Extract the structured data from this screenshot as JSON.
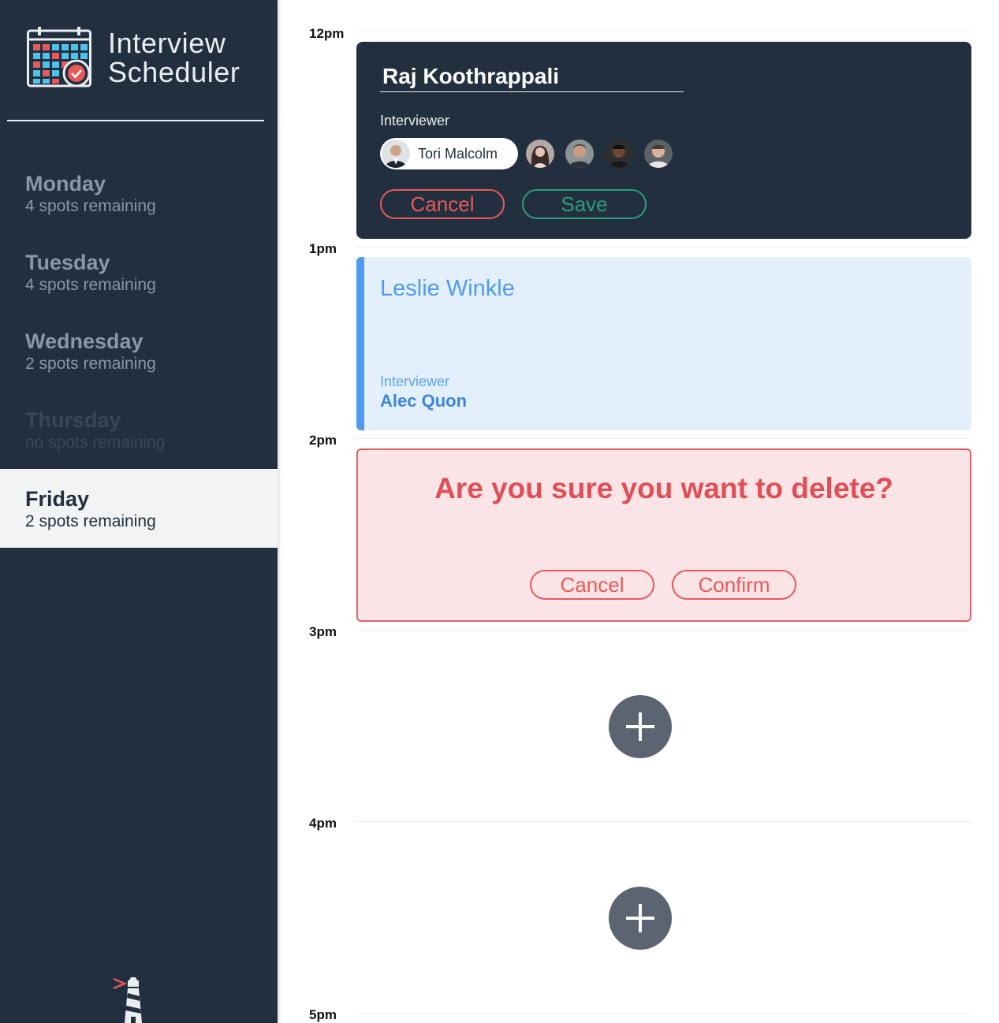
{
  "app": {
    "title_line1": "Interview",
    "title_line2": "Scheduler"
  },
  "sidebar": {
    "days": [
      {
        "name": "Monday",
        "spots": "4 spots remaining",
        "state": "available"
      },
      {
        "name": "Tuesday",
        "spots": "4 spots remaining",
        "state": "available"
      },
      {
        "name": "Wednesday",
        "spots": "2 spots remaining",
        "state": "available"
      },
      {
        "name": "Thursday",
        "spots": "no spots remaining",
        "state": "full"
      },
      {
        "name": "Friday",
        "spots": "2 spots remaining",
        "state": "selected"
      }
    ]
  },
  "schedule": {
    "hours": [
      "12pm",
      "1pm",
      "2pm",
      "3pm",
      "4pm",
      "5pm"
    ],
    "edit_form": {
      "student_name": "Raj Koothrappali",
      "interviewer_label": "Interviewer",
      "selected_interviewer": "Tori Malcolm",
      "other_interviewers_count": 4,
      "cancel_label": "Cancel",
      "save_label": "Save"
    },
    "appointment": {
      "student_name": "Leslie Winkle",
      "interviewer_label": "Interviewer",
      "interviewer_name": "Alec Quon"
    },
    "confirm": {
      "message": "Are you sure you want to delete?",
      "cancel_label": "Cancel",
      "confirm_label": "Confirm"
    }
  },
  "colors": {
    "sidebar_bg": "#222f3e",
    "accent_blue": "#4d9cf0",
    "danger_red": "#e85a5a",
    "save_green": "#2e9e7e"
  },
  "icons": [
    "calendar-logo-icon",
    "add-icon",
    "lighthouse-icon"
  ]
}
